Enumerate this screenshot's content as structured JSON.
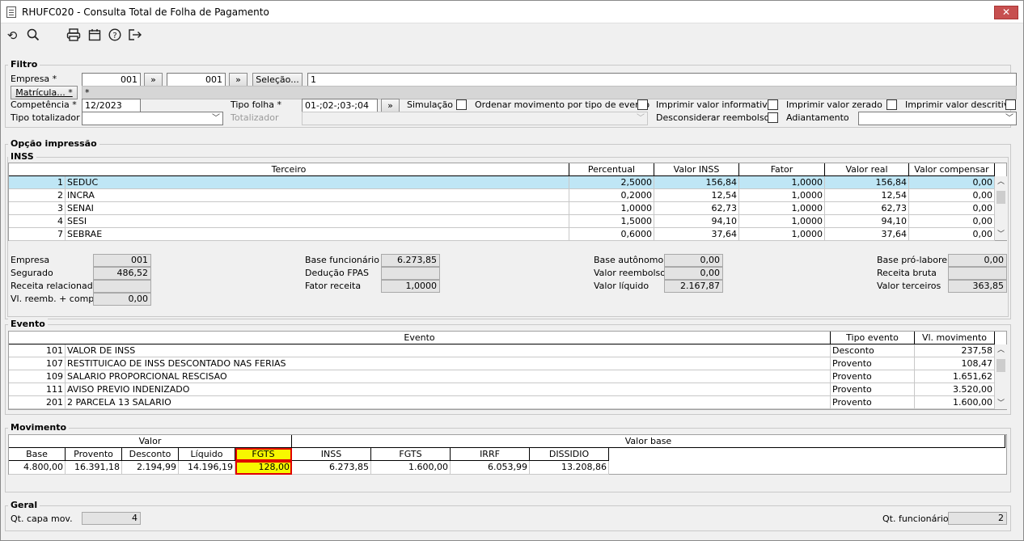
{
  "window": {
    "title": "RHUFC020 - Consulta Total de Folha de Pagamento",
    "close": "✕"
  },
  "toolbar": {
    "icons": [
      "refresh-icon",
      "search-icon",
      "print-icon",
      "calendar-icon",
      "help-icon",
      "exit-icon"
    ]
  },
  "filtro": {
    "title": "Filtro",
    "empresa_label": "Empresa *",
    "empresa_from": "001",
    "empresa_to": "001",
    "arrow": "»",
    "selecao_label": "Seleção...",
    "selecao_value": "1",
    "matricula_label": "Matrícula... *",
    "matricula_value": "*",
    "competencia_label": "Competência *",
    "competencia_value": "12/2023",
    "tipo_folha_label": "Tipo folha *",
    "tipo_folha_value": "01-;02-;03-;04",
    "simulacao_label": "Simulação",
    "ordenar_label": "Ordenar movimento por tipo de evento",
    "imprimir_informativo_label": "Imprimir valor informativo",
    "imprimir_zerado_label": "Imprimir valor zerado",
    "imprimir_descritivo_label": "Imprimir valor descritivo",
    "tipo_totalizador_label": "Tipo totalizador",
    "totalizador_label": "Totalizador",
    "desconsiderar_label": "Desconsiderar reembolso",
    "adiantamento_label": "Adiantamento"
  },
  "opcao": {
    "title": "Opção impressão"
  },
  "inss": {
    "title": "INSS",
    "columns": [
      "Terceiro",
      "Percentual",
      "Valor INSS",
      "Fator",
      "Valor real",
      "Valor compensar"
    ],
    "rows": [
      [
        "1",
        "SEDUC",
        "2,5000",
        "156,84",
        "1,0000",
        "156,84",
        "0,00"
      ],
      [
        "2",
        "INCRA",
        "0,2000",
        "12,54",
        "1,0000",
        "12,54",
        "0,00"
      ],
      [
        "3",
        "SENAI",
        "1,0000",
        "62,73",
        "1,0000",
        "62,73",
        "0,00"
      ],
      [
        "4",
        "SESI",
        "1,5000",
        "94,10",
        "1,0000",
        "94,10",
        "0,00"
      ],
      [
        "7",
        "SEBRAE",
        "0,6000",
        "37,64",
        "1,0000",
        "37,64",
        "0,00"
      ]
    ],
    "empresa_label": "Empresa",
    "empresa_value": "001",
    "segurado_label": "Segurado",
    "segurado_value": "486,52",
    "receita_rel_label": "Receita relacionada",
    "receita_rel_value": "",
    "vl_reemb_label": "Vl. reemb. + comp.",
    "vl_reemb_value": "0,00",
    "base_func_label": "Base funcionário",
    "base_func_value": "6.273,85",
    "deducao_label": "Dedução FPAS",
    "deducao_value": "",
    "fator_rec_label": "Fator receita",
    "fator_rec_value": "1,0000",
    "base_aut_label": "Base autônomo",
    "base_aut_value": "0,00",
    "valor_reemb_label": "Valor reembolso",
    "valor_reemb_value": "0,00",
    "valor_liq_label": "Valor líquido",
    "valor_liq_value": "2.167,87",
    "base_pro_label": "Base pró-labore",
    "base_pro_value": "0,00",
    "receita_bruta_label": "Receita bruta",
    "receita_bruta_value": "",
    "valor_terc_label": "Valor terceiros",
    "valor_terc_value": "363,85"
  },
  "evento": {
    "title": "Evento",
    "columns": [
      "Evento",
      "Tipo evento",
      "Vl. movimento"
    ],
    "rows": [
      [
        "101",
        "VALOR DE INSS",
        "Desconto",
        "237,58"
      ],
      [
        "107",
        "RESTITUICAO DE INSS DESCONTADO NAS FERIAS",
        "Provento",
        "108,47"
      ],
      [
        "109",
        "SALARIO PROPORCIONAL RESCISAO",
        "Provento",
        "1.651,62"
      ],
      [
        "111",
        "AVISO PREVIO INDENIZADO",
        "Provento",
        "3.520,00"
      ],
      [
        "201",
        "2 PARCELA 13 SALARIO",
        "Provento",
        "1.600,00"
      ]
    ]
  },
  "movimento": {
    "title": "Movimento",
    "group_valor": "Valor",
    "group_base": "Valor base",
    "columns": [
      "Base",
      "Provento",
      "Desconto",
      "Líquido",
      "FGTS",
      "INSS",
      "FGTS",
      "IRRF",
      "DISSIDIO"
    ],
    "values": [
      "4.800,00",
      "16.391,18",
      "2.194,99",
      "14.196,19",
      "128,00",
      "6.273,85",
      "1.600,00",
      "6.053,99",
      "13.208,86"
    ],
    "highlight_color": "#f7f700"
  },
  "geral": {
    "title": "Geral",
    "qt_capa_label": "Qt. capa mov.",
    "qt_capa_value": "4",
    "qt_func_label": "Qt. funcionário",
    "qt_func_value": "2"
  }
}
